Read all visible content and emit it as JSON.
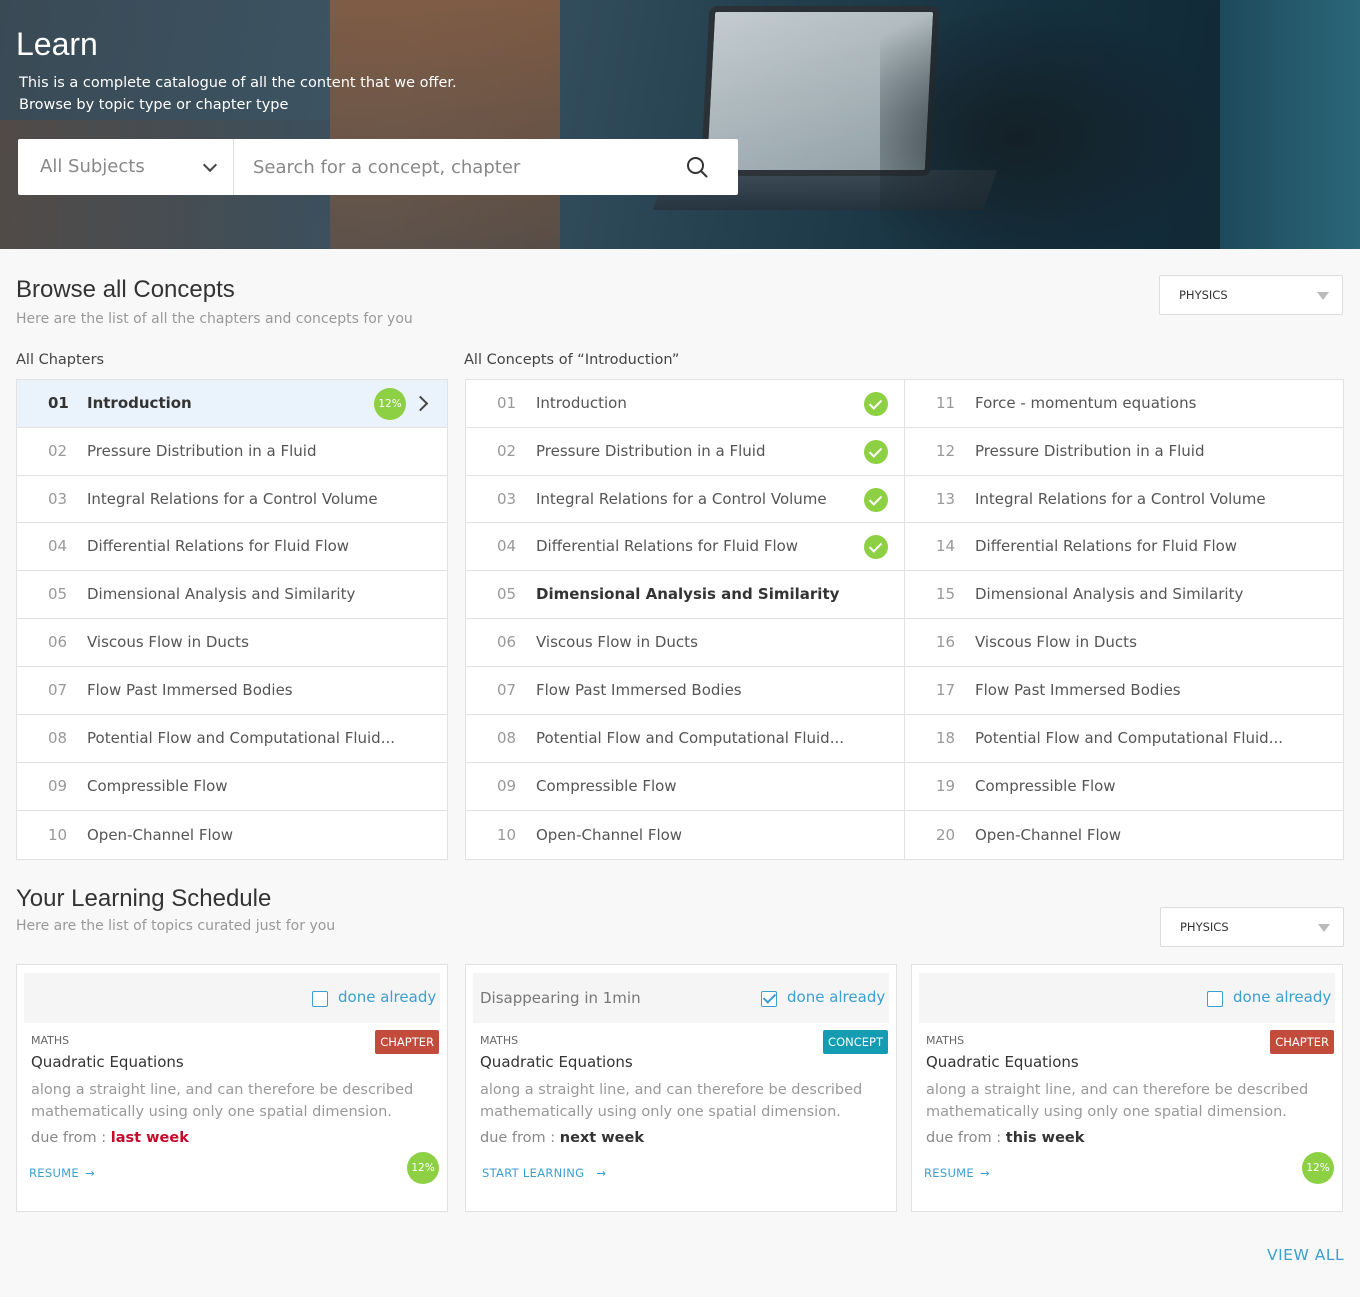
{
  "hero": {
    "title": "Learn",
    "subtitle_line1": "This is a complete catalogue of all the content that we offer.",
    "subtitle_line2": "Browse by topic type or chapter type",
    "subject_select": "All Subjects",
    "search_placeholder": "Search for a concept, chapter"
  },
  "browse": {
    "title": "Browse all Concepts",
    "subtitle": "Here are the list of all the chapters and concepts for you",
    "subject_dropdown": "PHYSICS",
    "chapters_heading": "All Chapters",
    "concepts_heading": "All Concepts of “Introduction”",
    "chapters": [
      {
        "num": "01",
        "label": "Introduction",
        "progress": "12%",
        "active": true
      },
      {
        "num": "02",
        "label": "Pressure Distribution in a Fluid"
      },
      {
        "num": "03",
        "label": "Integral Relations for a Control Volume"
      },
      {
        "num": "04",
        "label": "Differential Relations for Fluid Flow"
      },
      {
        "num": "05",
        "label": "Dimensional Analysis and Similarity"
      },
      {
        "num": "06",
        "label": "Viscous Flow in Ducts"
      },
      {
        "num": "07",
        "label": "Flow Past Immersed Bodies"
      },
      {
        "num": "08",
        "label": "Potential Flow and Computational Fluid..."
      },
      {
        "num": "09",
        "label": "Compressible Flow"
      },
      {
        "num": "10",
        "label": "Open-Channel Flow"
      }
    ],
    "concepts_left": [
      {
        "num": "01",
        "label": "Introduction",
        "done": true
      },
      {
        "num": "02",
        "label": "Pressure Distribution in a Fluid",
        "done": true
      },
      {
        "num": "03",
        "label": "Integral Relations for a Control Volume",
        "done": true
      },
      {
        "num": "04",
        "label": "Differential Relations for Fluid Flow",
        "done": true
      },
      {
        "num": "05",
        "label": "Dimensional Analysis and Similarity",
        "current": true
      },
      {
        "num": "06",
        "label": "Viscous Flow in Ducts"
      },
      {
        "num": "07",
        "label": "Flow Past Immersed Bodies"
      },
      {
        "num": "08",
        "label": "Potential Flow and Computational Fluid..."
      },
      {
        "num": "09",
        "label": "Compressible Flow"
      },
      {
        "num": "10",
        "label": "Open-Channel Flow"
      }
    ],
    "concepts_right": [
      {
        "num": "11",
        "label": "Force - momentum equations"
      },
      {
        "num": "12",
        "label": "Pressure Distribution in a Fluid"
      },
      {
        "num": "13",
        "label": "Integral Relations for a Control Volume"
      },
      {
        "num": "14",
        "label": "Differential Relations for Fluid Flow"
      },
      {
        "num": "15",
        "label": "Dimensional Analysis and Similarity"
      },
      {
        "num": "16",
        "label": "Viscous Flow in Ducts"
      },
      {
        "num": "17",
        "label": "Flow Past Immersed Bodies"
      },
      {
        "num": "18",
        "label": "Potential Flow and Computational Fluid..."
      },
      {
        "num": "19",
        "label": "Compressible Flow"
      },
      {
        "num": "20",
        "label": "Open-Channel Flow"
      }
    ]
  },
  "schedule": {
    "title": "Your Learning Schedule",
    "subtitle": "Here are the  list of topics curated just for you",
    "subject_dropdown": "PHYSICS",
    "view_all": "VIEW ALL",
    "cards": [
      {
        "top_text": "",
        "done_label": "done already",
        "done_checked": false,
        "subject": "MATHS",
        "badge": "CHAPTER",
        "title": "Quadratic Equations",
        "desc_line1": "along a straight line, and can therefore be described",
        "desc_line2": "mathematically using only one spatial dimension.",
        "due_prefix": "due from : ",
        "due_value": "last week",
        "cta": "RESUME",
        "progress": "12%"
      },
      {
        "top_text": "Disappearing in 1min",
        "done_label": "done already",
        "done_checked": true,
        "subject": "MATHS",
        "badge": "CONCEPT",
        "title": "Quadratic Equations",
        "desc_line1": "along a straight line, and can therefore be described",
        "desc_line2": "mathematically using only one spatial dimension.",
        "due_prefix": "due from : ",
        "due_value": "next week",
        "cta": "START LEARNING",
        "progress": ""
      },
      {
        "top_text": "",
        "done_label": "done already",
        "done_checked": false,
        "subject": "MATHS",
        "badge": "CHAPTER",
        "title": "Quadratic Equations",
        "desc_line1": "along a straight line, and can therefore be described",
        "desc_line2": "mathematically using only one spatial dimension.",
        "due_prefix": "due from : ",
        "due_value": "this week",
        "cta": "RESUME",
        "progress": "12%"
      }
    ]
  },
  "colors": {
    "accent": "#3b9fd0",
    "success": "#8ed043",
    "badge_chapter": "#c24b3b",
    "badge_concept": "#149db2",
    "late": "#c40b2b"
  }
}
